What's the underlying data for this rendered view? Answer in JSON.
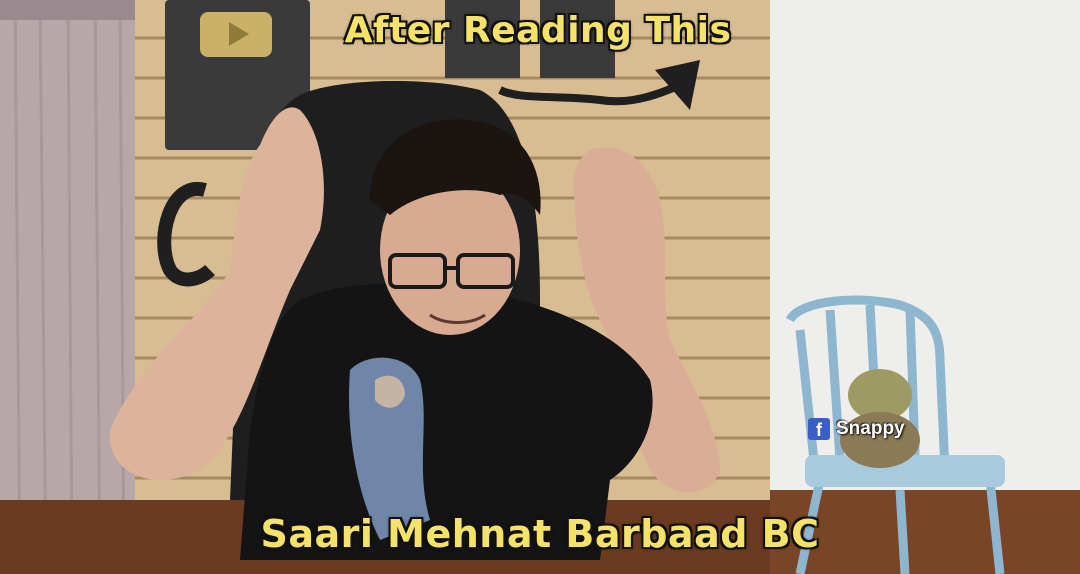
{
  "captions": {
    "top": "After Reading This",
    "bottom": "Saari Mehnat Barbaad BC"
  },
  "watermark": {
    "icon": "facebook-icon",
    "text": "Snappy"
  },
  "colors": {
    "caption_fill": "#f4e26a",
    "caption_outline": "#111111",
    "facebook_blue": "#3b5ec6"
  }
}
